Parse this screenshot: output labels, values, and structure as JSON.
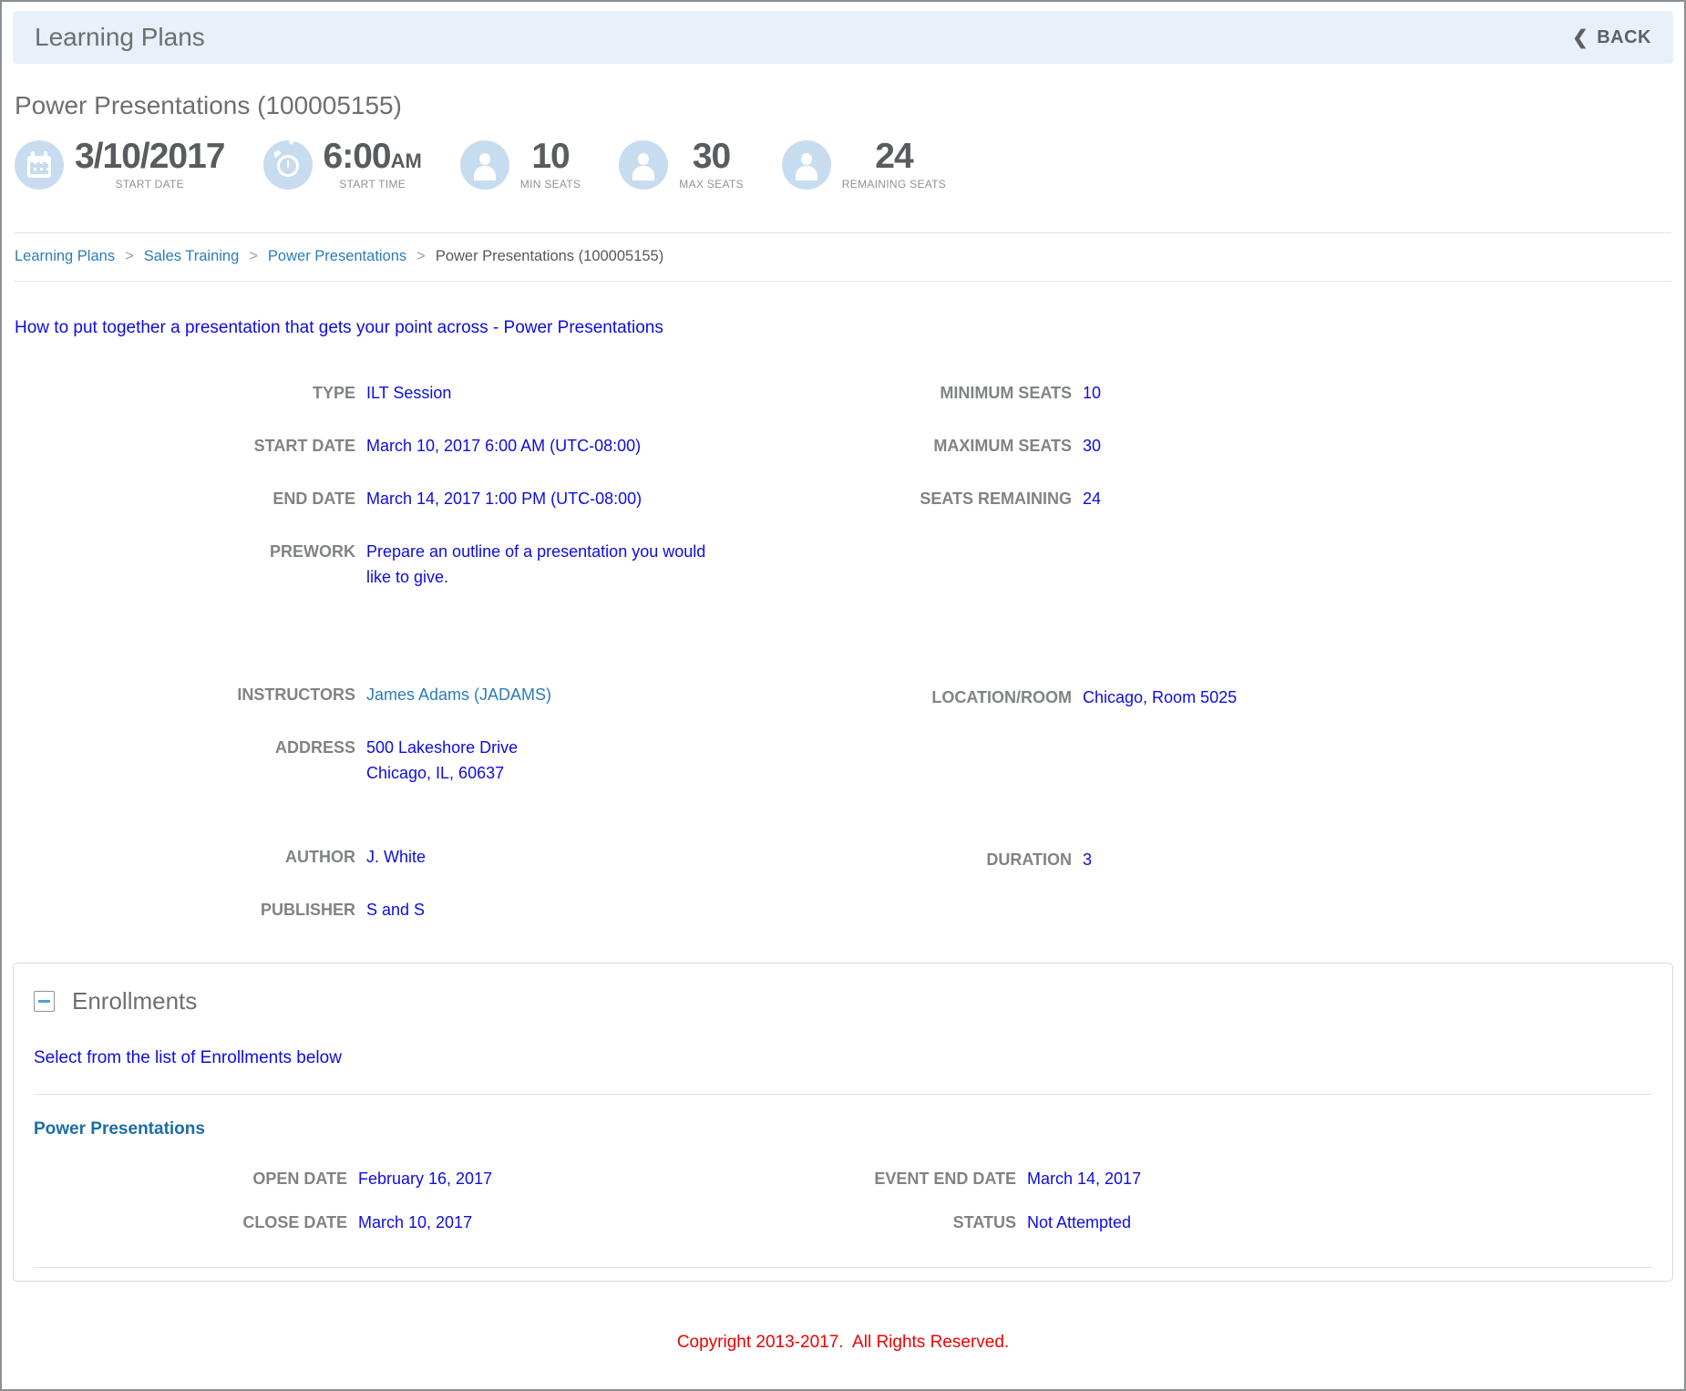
{
  "header": {
    "title": "Learning Plans",
    "back_label": "BACK",
    "back_icon": "chevron-left-icon"
  },
  "page": {
    "title": "Power Presentations (100005155)"
  },
  "stats": [
    {
      "icon": "calendar-icon",
      "value": "3/10/2017",
      "label": "START DATE"
    },
    {
      "icon": "alarm-clock-icon",
      "value": "6:00",
      "suffix": "AM",
      "label": "START TIME"
    },
    {
      "icon": "person-icon",
      "value": "10",
      "label": "MIN SEATS"
    },
    {
      "icon": "person-icon",
      "value": "30",
      "label": "MAX SEATS"
    },
    {
      "icon": "person-icon",
      "value": "24",
      "label": "REMAINING SEATS"
    }
  ],
  "breadcrumb": {
    "separator": ">",
    "links": [
      "Learning Plans",
      "Sales Training",
      "Power Presentations"
    ],
    "current": "Power Presentations (100005155)"
  },
  "description_link": "How to put together a presentation that gets your point across - Power Presentations",
  "details": {
    "type_label": "TYPE",
    "type": "ILT Session",
    "start_date_label": "START DATE",
    "start_date": "March 10, 2017 6:00 AM (UTC-08:00)",
    "end_date_label": "END DATE",
    "end_date": "March 14, 2017 1:00 PM (UTC-08:00)",
    "prework_label": "PREWORK",
    "prework": "Prepare an outline of a presentation you would like to give.",
    "min_seats_label": "MINIMUM SEATS",
    "min_seats": "10",
    "max_seats_label": "MAXIMUM SEATS",
    "max_seats": "30",
    "seats_remaining_label": "SEATS REMAINING",
    "seats_remaining": "24",
    "instructors_label": "INSTRUCTORS",
    "instructors": "James Adams (JADAMS)",
    "location_label": "LOCATION/ROOM",
    "location": "Chicago, Room 5025",
    "address_label": "ADDRESS",
    "address_line1": "500 Lakeshore Drive",
    "address_line2": "Chicago, IL, 60637",
    "author_label": "AUTHOR",
    "author": "J. White",
    "duration_label": "DURATION",
    "duration": "3",
    "publisher_label": "PUBLISHER",
    "publisher": "S and S"
  },
  "enrollments": {
    "title": "Enrollments",
    "collapse_icon": "minus-icon",
    "select_text": "Select from the list of Enrollments below",
    "course_name": "Power Presentations",
    "open_date_label": "OPEN DATE",
    "open_date": "February 16, 2017",
    "close_date_label": "CLOSE DATE",
    "close_date": "March 10, 2017",
    "event_end_date_label": "EVENT END DATE",
    "event_end_date": "March 14, 2017",
    "status_label": "STATUS",
    "status": "Not Attempted"
  },
  "footer": {
    "copyright": "Copyright 2013-2017.  All Rights Reserved."
  },
  "colors": {
    "topbar_bg": "#e8f0f9",
    "icon_circle": "#c8dcf0",
    "heading_gray": "#6d6f71",
    "label_gray": "#808386",
    "value_blue": "#0d0de0",
    "link_blue": "#2d7cb8",
    "enroll_course_blue": "#1b6ca8",
    "copyright_red": "#ee0000"
  }
}
